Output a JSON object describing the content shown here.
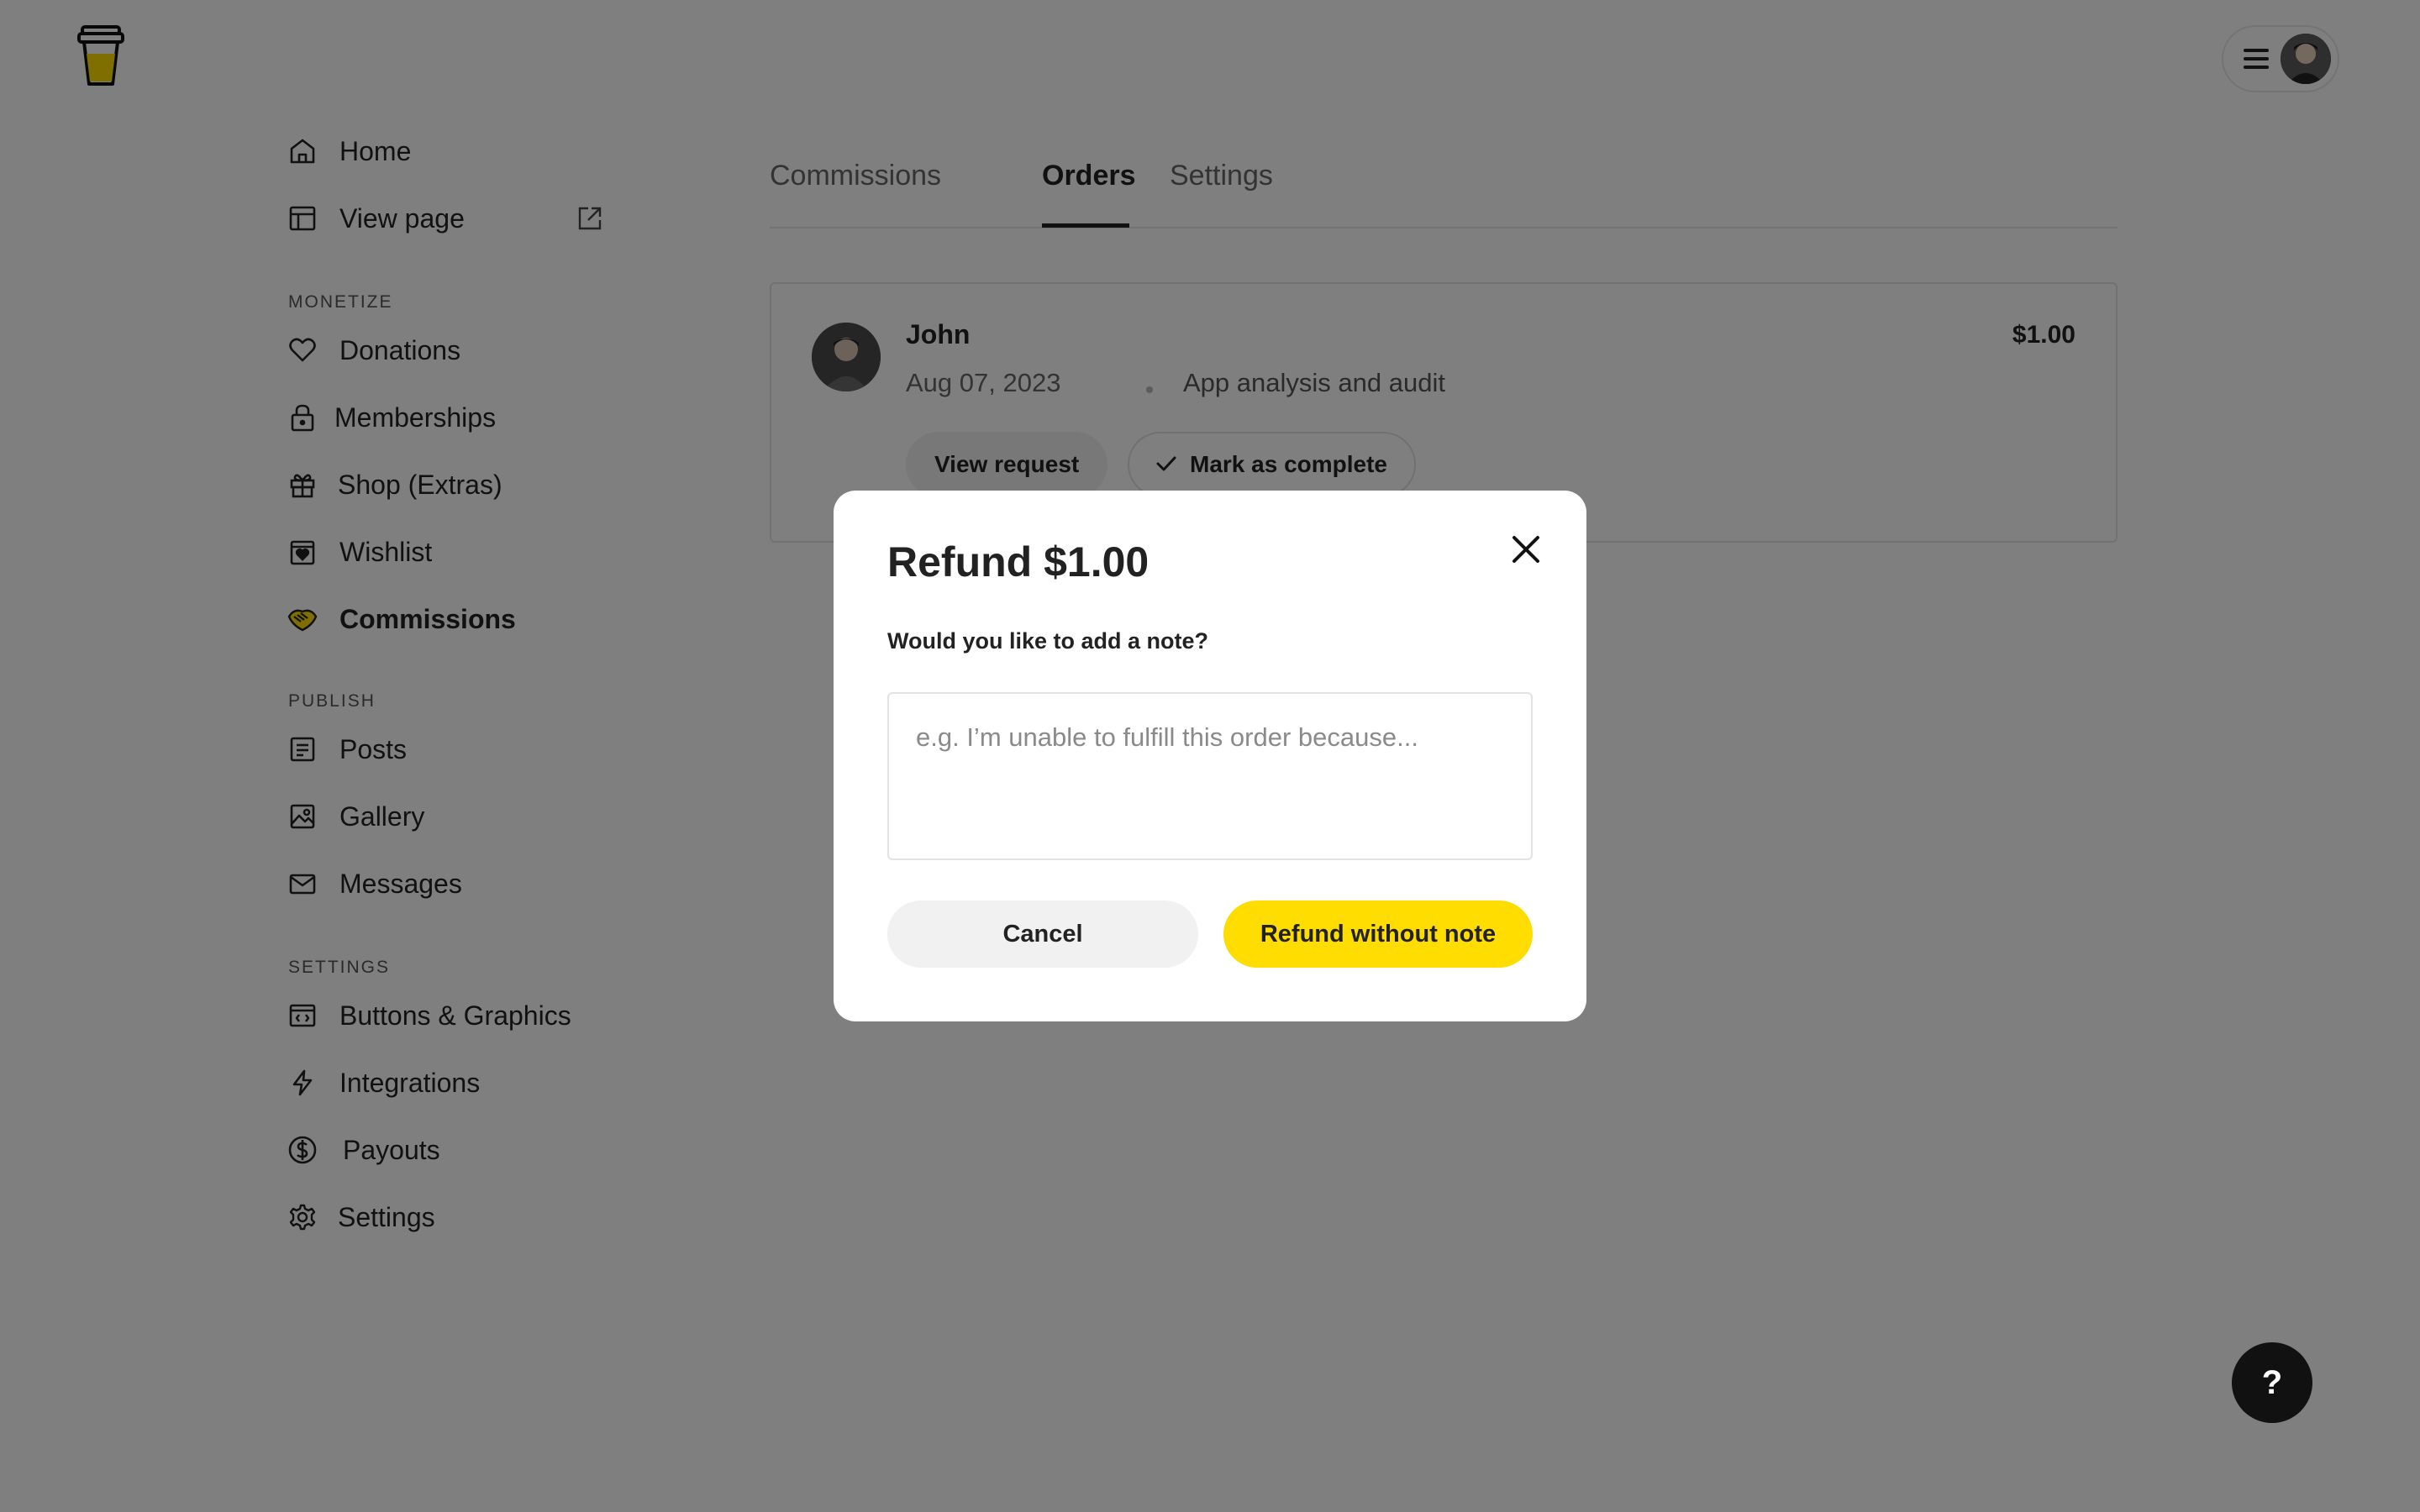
{
  "colors": {
    "accent_yellow": "#FFDD00",
    "overlay": "#000000",
    "text_primary": "#222222"
  },
  "sidebar": {
    "items_top": [
      {
        "label": "Home",
        "icon": "home-icon"
      },
      {
        "label": "View page",
        "icon": "layout-icon",
        "trailing_icon": "external-link-icon"
      }
    ],
    "monetize": {
      "section_label": "MONETIZE",
      "items": [
        {
          "label": "Donations",
          "icon": "heart-icon"
        },
        {
          "label": "Memberships",
          "icon": "lock-icon"
        },
        {
          "label": "Shop (Extras)",
          "icon": "gift-icon"
        },
        {
          "label": "Wishlist",
          "icon": "wishlist-icon"
        },
        {
          "label": "Commissions",
          "icon": "handshake-icon",
          "active": true
        }
      ]
    },
    "publish": {
      "section_label": "PUBLISH",
      "items": [
        {
          "label": "Posts",
          "icon": "document-icon"
        },
        {
          "label": "Gallery",
          "icon": "image-icon"
        },
        {
          "label": "Messages",
          "icon": "mail-icon"
        }
      ]
    },
    "settings": {
      "section_label": "SETTINGS",
      "items": [
        {
          "label": "Buttons & Graphics",
          "icon": "code-window-icon"
        },
        {
          "label": "Integrations",
          "icon": "bolt-icon"
        },
        {
          "label": "Payouts",
          "icon": "dollar-circle-icon"
        },
        {
          "label": "Settings",
          "icon": "gear-icon"
        }
      ]
    }
  },
  "main": {
    "tabs": [
      {
        "label": "Commissions"
      },
      {
        "label": "Orders",
        "active": true
      },
      {
        "label": "Settings"
      }
    ],
    "order": {
      "name": "John",
      "amount": "$1.00",
      "date": "Aug 07, 2023",
      "service": "App analysis and audit",
      "view_label": "View request",
      "complete_label": "Mark as complete"
    }
  },
  "modal": {
    "title": "Refund $1.00",
    "question": "Would you like to add a note?",
    "note_placeholder": "e.g. I’m unable to fulfill this order because...",
    "note_value": "",
    "cancel_label": "Cancel",
    "refund_label": "Refund without note"
  },
  "help": {
    "label": "?"
  }
}
